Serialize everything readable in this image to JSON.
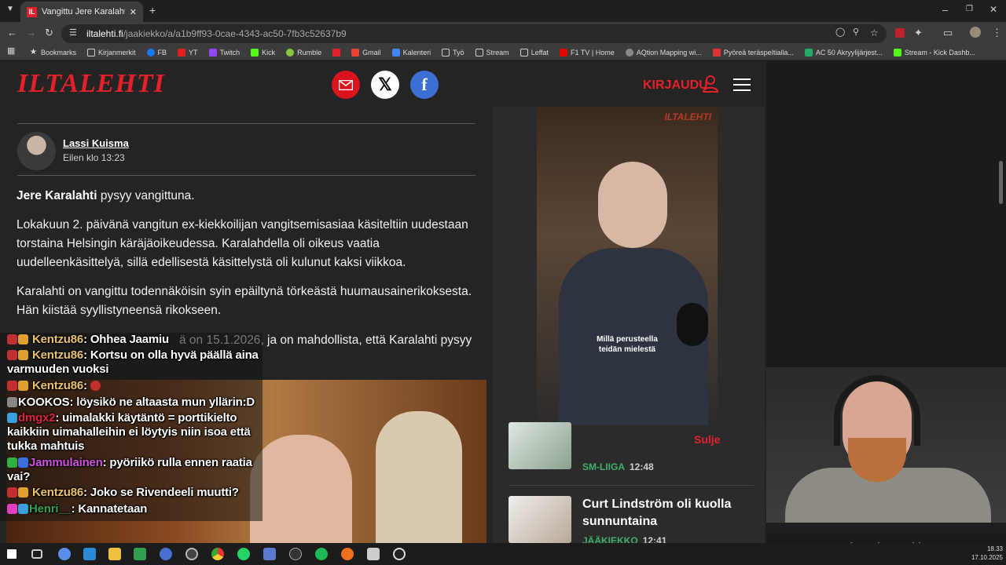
{
  "browser": {
    "tab_title": "Vangittu Jere Karalahti vetosi ra",
    "tab_favicon": "IL",
    "url_host": "iltalehti.fi",
    "url_path": "/jaakiekko/a/a1b9ff93-0cae-4343-ac50-7fb3c52637b9",
    "bookmarks": [
      "Bookmarks",
      "Kirjanmerkit",
      "FB",
      "YT",
      "Twitch",
      "Kick",
      "Rumble",
      "",
      "Gmail",
      "Kalenteri",
      "Työ",
      "Stream",
      "Leffat",
      "F1 TV | Home",
      "AQtion Mapping wi...",
      "Pyöreä teräspeltialla...",
      "AC 50 Akryylijärjest...",
      "Stream - Kick Dashb..."
    ]
  },
  "header": {
    "logo": "ILTALEHTI",
    "login_label": "KIRJAUDU"
  },
  "article": {
    "author_name": "Lassi Kuisma",
    "author_time": "Eilen klo 13:23",
    "lead_bold": "Jere Karalahti",
    "lead_rest": " pysyy vangittuna.",
    "para1": "Lokakuun 2. päivänä vangitun ex-kiekkoilijan vangitsemisasiaa käsiteltiin uudestaan torstaina Helsingin käräjäoikeudessa. Karalahdella oli oikeus vaatia uudelleenkäsittelyä, sillä edellisestä käsittelystä oli kulunut kaksi viikkoa.",
    "para2": "Karalahti on vangittu todennäköisin syin epäiltynä törkeästä huumausainerikoksesta. Hän kiistää syyllistyneensä rikokseen.",
    "para3_visible": "ä on 15.1.2026, ja on mahdollista, että Karalahti pysyy"
  },
  "video": {
    "watermark": "ILTALEHTI",
    "caption_line1": "Millä perusteella",
    "caption_line2": "teidän mielestä",
    "close_label": "Sulje"
  },
  "news": [
    {
      "title": "",
      "category": "SM-LIIGA",
      "time": "12:48"
    },
    {
      "title": "Curt Lindström oli kuolla sunnuntaina",
      "category": "JÄÄKIEKKO",
      "time": "12:41"
    }
  ],
  "chat": [
    {
      "user": "Kentzu86",
      "text": ": Ohhea Jaamiu"
    },
    {
      "user": "Kentzu86",
      "text": ": Kortsu on olla hyvä päällä aina varmuuden vuoksi"
    },
    {
      "user": "Kentzu86",
      "text": ":"
    },
    {
      "user": "KOOKOS",
      "text": ": löysikö ne altaasta mun yllärin:D"
    },
    {
      "user": "dmgx2",
      "text": ": uimalakki käytäntö = porttikielto kaikkiin uimahalleihin ei löytyis niin isoa että tukka mahtuis"
    },
    {
      "user": "Jammulainen",
      "text": ": pyöriikö rulla ennen raatia vai?"
    },
    {
      "user": "Kentzu86",
      "text": ": Joko se Rivendeeli muutti?"
    },
    {
      "user": "Henri__",
      "text": ": Kannatetaan"
    }
  ],
  "stream": {
    "now_playing": "Us Against The World"
  },
  "taskbar": {
    "time": "18.33",
    "date": "17.10.2025"
  },
  "colors": {
    "brand_red": "#e4202b",
    "category_green": "#3fae6a",
    "page_bg": "#242424"
  }
}
